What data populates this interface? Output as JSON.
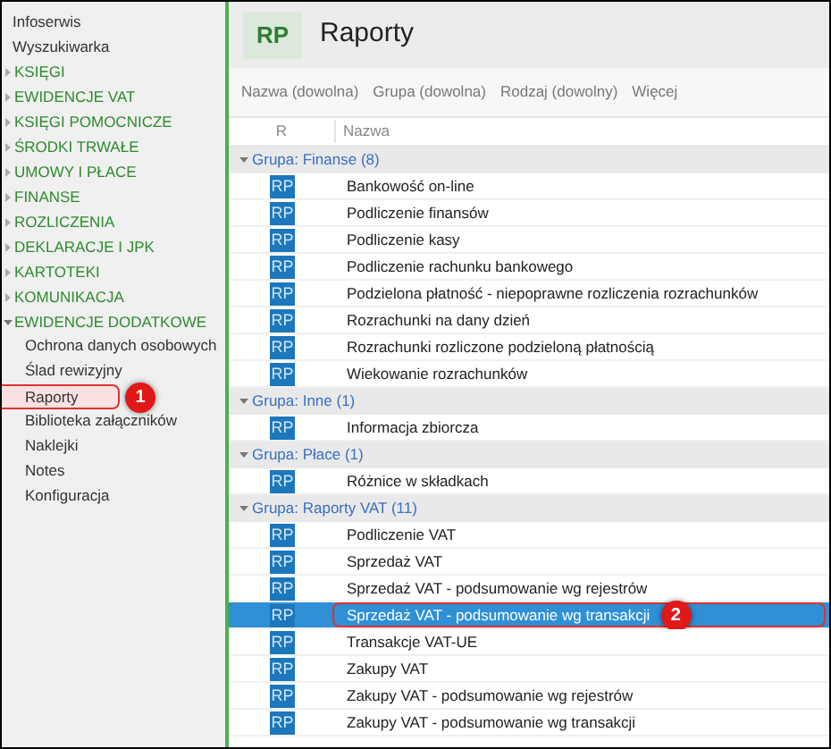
{
  "sidebar": {
    "items": [
      {
        "kind": "link",
        "label": "Infoserwis"
      },
      {
        "kind": "link",
        "label": "Wyszukiwarka"
      },
      {
        "kind": "section",
        "label": "KSIĘGI",
        "expanded": false
      },
      {
        "kind": "section",
        "label": "EWIDENCJE VAT",
        "expanded": false
      },
      {
        "kind": "section",
        "label": "KSIĘGI POMOCNICZE",
        "expanded": false
      },
      {
        "kind": "section",
        "label": "ŚRODKI TRWAŁE",
        "expanded": false
      },
      {
        "kind": "section",
        "label": "UMOWY I PŁACE",
        "expanded": false
      },
      {
        "kind": "section",
        "label": "FINANSE",
        "expanded": false
      },
      {
        "kind": "section",
        "label": "ROZLICZENIA",
        "expanded": false
      },
      {
        "kind": "section",
        "label": "DEKLARACJE I JPK",
        "expanded": false
      },
      {
        "kind": "section",
        "label": "KARTOTEKI",
        "expanded": false
      },
      {
        "kind": "section",
        "label": "KOMUNIKACJA",
        "expanded": false
      },
      {
        "kind": "section",
        "label": "EWIDENCJE DODATKOWE",
        "expanded": true,
        "children": [
          {
            "label": "Ochrona danych osobowych",
            "selected": false
          },
          {
            "label": "Ślad rewizyjny",
            "selected": false
          },
          {
            "label": "Raporty",
            "selected": true,
            "callout": "1"
          },
          {
            "label": "Biblioteka załączników",
            "selected": false
          },
          {
            "label": "Naklejki",
            "selected": false
          },
          {
            "label": "Notes",
            "selected": false
          },
          {
            "label": "Konfiguracja",
            "selected": false
          }
        ]
      }
    ]
  },
  "header": {
    "tile": "RP",
    "title": "Raporty"
  },
  "filters": [
    "Nazwa (dowolna)",
    "Grupa (dowolna)",
    "Rodzaj (dowolny)",
    "Więcej"
  ],
  "table": {
    "columns": [
      "R",
      "Nazwa"
    ],
    "groups": [
      {
        "label": "Grupa: Finanse (8)",
        "expanded": true,
        "rows": [
          {
            "icon": "RP",
            "name": "Bankowość on-line",
            "selected": false
          },
          {
            "icon": "RP",
            "name": "Podliczenie finansów",
            "selected": false
          },
          {
            "icon": "RP",
            "name": "Podliczenie kasy",
            "selected": false
          },
          {
            "icon": "RP",
            "name": "Podliczenie rachunku bankowego",
            "selected": false
          },
          {
            "icon": "RP",
            "name": "Podzielona płatność - niepoprawne rozliczenia rozrachunków",
            "selected": false
          },
          {
            "icon": "RP",
            "name": "Rozrachunki na dany dzień",
            "selected": false
          },
          {
            "icon": "RP",
            "name": "Rozrachunki rozliczone podzieloną płatnością",
            "selected": false
          },
          {
            "icon": "RP",
            "name": "Wiekowanie rozrachunków",
            "selected": false
          }
        ]
      },
      {
        "label": "Grupa: Inne (1)",
        "expanded": true,
        "rows": [
          {
            "icon": "RP",
            "name": "Informacja zbiorcza",
            "selected": false
          }
        ]
      },
      {
        "label": "Grupa: Płace (1)",
        "expanded": true,
        "rows": [
          {
            "icon": "RP",
            "name": "Różnice w składkach",
            "selected": false
          }
        ]
      },
      {
        "label": "Grupa: Raporty VAT (11)",
        "expanded": true,
        "rows": [
          {
            "icon": "RP",
            "name": "Podliczenie VAT",
            "selected": false
          },
          {
            "icon": "RP",
            "name": "Sprzedaż VAT",
            "selected": false
          },
          {
            "icon": "RP",
            "name": "Sprzedaż VAT - podsumowanie wg rejestrów",
            "selected": false
          },
          {
            "icon": "RP",
            "name": "Sprzedaż VAT - podsumowanie wg transakcji",
            "selected": true,
            "callout": "2"
          },
          {
            "icon": "RP",
            "name": "Transakcje VAT-UE",
            "selected": false
          },
          {
            "icon": "RP",
            "name": "Zakupy VAT",
            "selected": false
          },
          {
            "icon": "RP",
            "name": "Zakupy VAT - podsumowanie wg rejestrów",
            "selected": false
          },
          {
            "icon": "RP",
            "name": "Zakupy VAT - podsumowanie wg transakcji",
            "selected": false
          }
        ]
      }
    ]
  }
}
